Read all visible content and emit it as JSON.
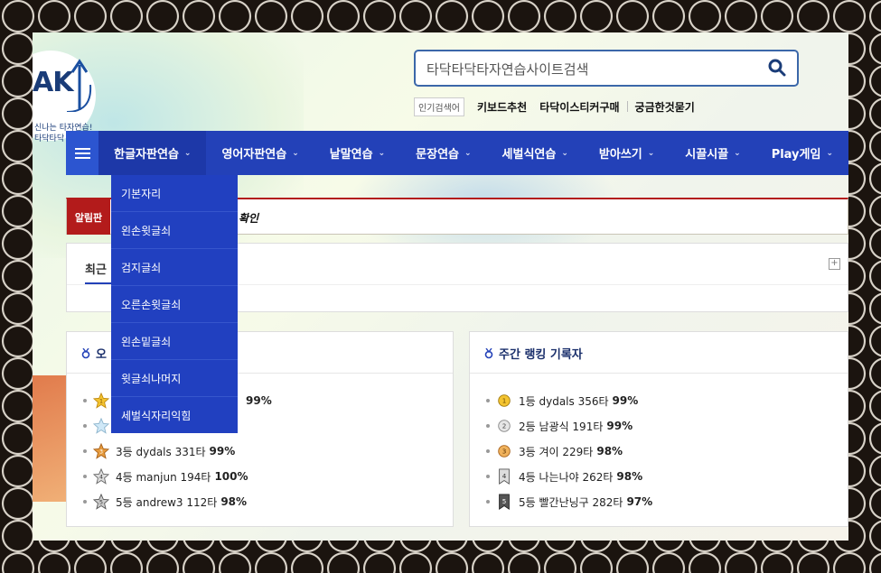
{
  "logo": {
    "text": "AK",
    "line1": "신나는 타자연습!",
    "line2": "타닥타닥 타자연습!"
  },
  "search": {
    "placeholder": "타닥타닥타자연습사이트검색"
  },
  "popular": {
    "tag": "인기검색어",
    "keywords": [
      "키보드추천",
      "타닥이스티커구매",
      "궁금한것묻기"
    ]
  },
  "nav": {
    "items": [
      "한글자판연습",
      "영어자판연습",
      "낱말연습",
      "문장연습",
      "세벌식연습",
      "받아쓰기",
      "시끌시끌",
      "Play게임"
    ],
    "chevron": "⌄"
  },
  "dropdown": {
    "items": [
      "기본자리",
      "왼손윗글쇠",
      "검지글쇠",
      "오른손윗글쇠",
      "왼손밑글쇠",
      "윗글쇠나머지",
      "세벌식자리익힘"
    ]
  },
  "notice": {
    "label": "알림판",
    "text": "확인"
  },
  "recent": {
    "tab": "최근"
  },
  "rank_left": {
    "title": "오",
    "rows": [
      {
        "text": "",
        "score": "99%"
      },
      {
        "text": "",
        "score": ""
      },
      {
        "text": "3등 dydals 331타",
        "score": "99%"
      },
      {
        "text": "4등 manjun 194타",
        "score": "100%"
      },
      {
        "text": "5등 andrew3 112타",
        "score": "98%"
      }
    ]
  },
  "rank_right": {
    "title": "주간 랭킹 기록자",
    "rows": [
      {
        "text": "1등 dydals 356타",
        "score": "99%"
      },
      {
        "text": "2등 남광식 191타",
        "score": "99%"
      },
      {
        "text": "3등 겨이 229타",
        "score": "98%"
      },
      {
        "text": "4등 나는나야 262타",
        "score": "98%"
      },
      {
        "text": "5등 빨간난닝구 282타",
        "score": "97%"
      }
    ]
  },
  "colors": {
    "nav": "#2341b8",
    "accent": "#b31b1b",
    "title": "#1a2f6b"
  }
}
